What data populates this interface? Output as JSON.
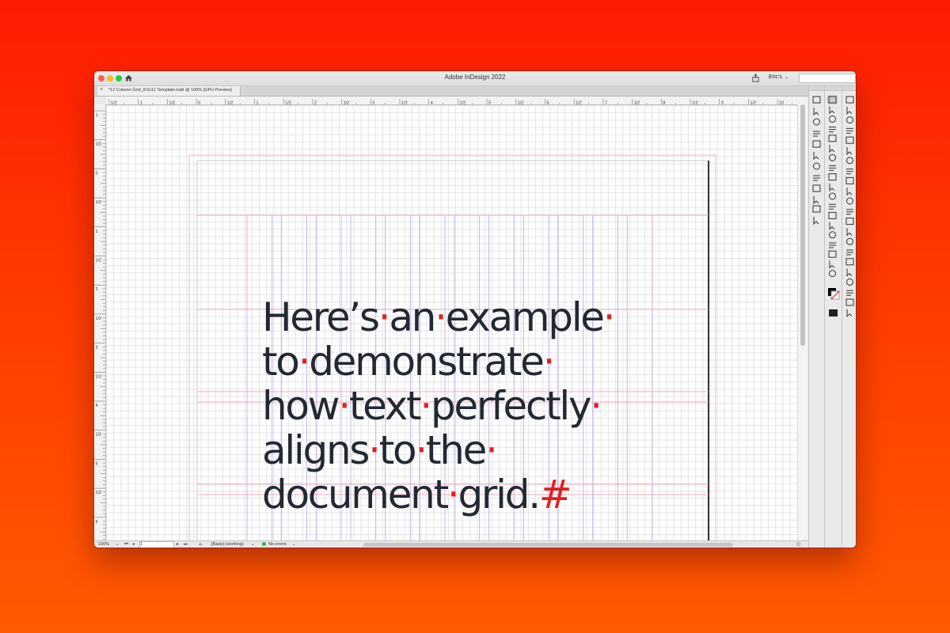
{
  "app": {
    "window_title": "Adobe InDesign 2022",
    "user_menu": "Eric's",
    "document_tab": "*12 Column Grid_8.5x11 Template.indd @ 100% [GPU Preview]"
  },
  "ruler": {
    "horizontal_labels": [
      "1/2",
      "1",
      "1/2",
      "0",
      "1/2",
      "1",
      "1/2",
      "2",
      "1/2",
      "3",
      "1/2",
      "4",
      "1/2",
      "5",
      "1/2",
      "6",
      "1/2",
      "7",
      "1/2",
      "8",
      "1/2",
      "9",
      "1/2",
      "10"
    ],
    "vertical_labels": [
      "1",
      "1/2",
      "0",
      "1/2",
      "1",
      "1/2",
      "2",
      "1/2",
      "3",
      "1/2",
      "4",
      "1/2",
      "5",
      "1/2",
      "6"
    ]
  },
  "document": {
    "text_lines": [
      [
        "Here’s",
        "an",
        "example",
        ""
      ],
      [
        "to",
        "demonstrate",
        ""
      ],
      [
        "how",
        "text",
        "perfectly",
        ""
      ],
      [
        "aligns",
        "to",
        "the",
        ""
      ],
      [
        "document",
        "grid."
      ]
    ],
    "space_marker": "·",
    "end_marker": "#",
    "text_color": "#222933",
    "marker_color": "#e02020"
  },
  "status": {
    "zoom": "100%",
    "page": "1",
    "style": "[Basic] (working)",
    "preflight": "No errors"
  },
  "colors": {
    "background_top": "#ff1c02",
    "background_bottom": "#ff5a00",
    "margin_guide": "#f0a8b8",
    "column_guide": "#b9a6e6"
  },
  "toolbar": {
    "icons": [
      "selection-tool-icon",
      "direct-selection-icon",
      "page-tool-icon",
      "gap-tool-icon",
      "content-collector-icon",
      "type-tool-icon",
      "line-tool-icon",
      "pen-tool-icon",
      "pencil-tool-icon",
      "rectangle-frame-icon",
      "rectangle-tool-icon",
      "scissors-tool-icon",
      "free-transform-icon",
      "gradient-swatch-icon",
      "gradient-feather-icon",
      "note-tool-icon",
      "eyedropper-icon",
      "hand-tool-icon",
      "zoom-tool-icon"
    ]
  }
}
